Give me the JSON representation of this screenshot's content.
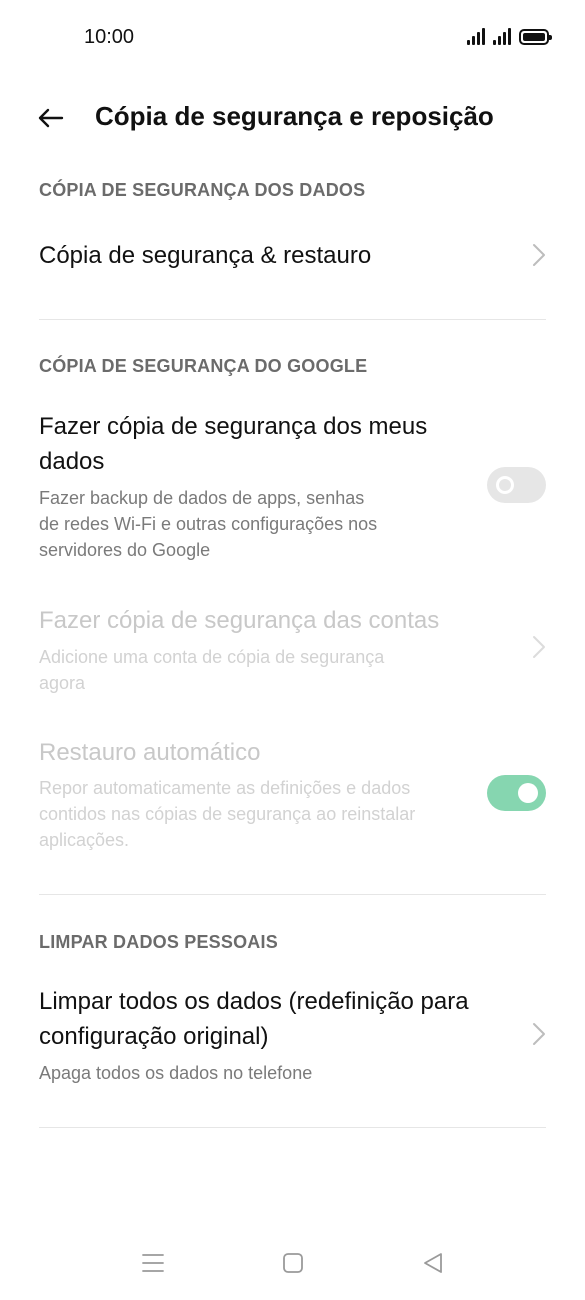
{
  "status": {
    "time": "10:00"
  },
  "header": {
    "title": "Cópia de segurança e reposição"
  },
  "sections": {
    "data_backup": {
      "title": "CÓPIA DE SEGURANÇA DOS DADOS",
      "backup_restore": {
        "label": "Cópia de segurança & restauro"
      }
    },
    "google_backup": {
      "title": "CÓPIA DE SEGURANÇA DO GOOGLE",
      "backup_my_data": {
        "title_line1": "Fazer cópia de segurança dos meus",
        "title_line2": "dados",
        "sub_line1": "Fazer backup de dados de apps, senhas",
        "sub_line2": "de redes Wi-Fi e outras configurações nos",
        "sub_line3": "servidores do Google",
        "toggle_state": "off"
      },
      "backup_accounts": {
        "title": "Fazer cópia de segurança das contas",
        "sub_line1": "Adicione uma conta de cópia de segurança",
        "sub_line2": "agora"
      },
      "auto_restore": {
        "title": "Restauro automático",
        "sub_line1": "Repor automaticamente as definições e dados",
        "sub_line2": "contidos nas cópias de segurança ao reinstalar",
        "sub_line3": "aplicações.",
        "toggle_state": "on"
      }
    },
    "personal_data": {
      "title": "LIMPAR DADOS PESSOAIS",
      "factory_reset": {
        "title_line1": "Limpar todos os dados (redefinição para",
        "title_line2": "configuração original)",
        "sub": "Apaga todos os dados no telefone"
      }
    }
  },
  "colors": {
    "toggle_on": "#86d6b0",
    "toggle_off": "#e6e6e6",
    "section_title": "#6b6b6b",
    "disabled_text": "#c8c8c8"
  },
  "navbar": {
    "icons": [
      "menu-icon",
      "home-icon",
      "back-icon"
    ]
  }
}
